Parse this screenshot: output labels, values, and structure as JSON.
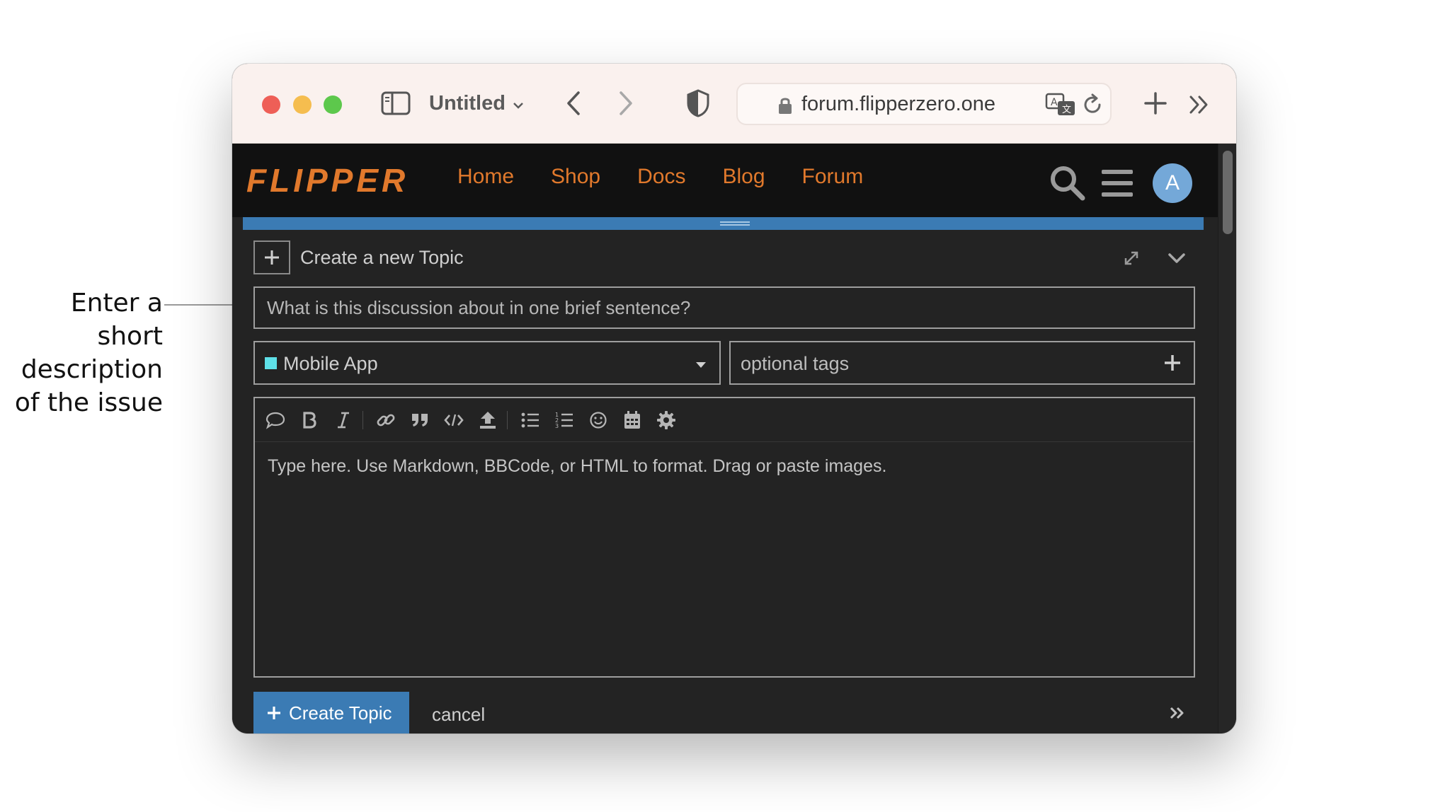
{
  "annotation": {
    "lines": [
      "Enter a short",
      "description",
      "of the issue"
    ]
  },
  "browser": {
    "tab_title": "Untitled",
    "url": "forum.flipperzero.one",
    "icons": {
      "sidebar": "sidebar-icon",
      "back": "chevron-left-icon",
      "forward": "chevron-right-icon",
      "privacy": "shield-icon",
      "lock": "lock-icon",
      "translate": "translate-icon",
      "reload": "reload-icon",
      "new_tab": "plus-icon",
      "more": "double-chevron-right-icon"
    }
  },
  "site": {
    "logo_text": "FLIPPER",
    "nav": [
      "Home",
      "Shop",
      "Docs",
      "Blog",
      "Forum"
    ],
    "avatar_letter": "A",
    "colors": {
      "accent": "#e1792c",
      "header_bg": "#111111",
      "primary": "#3b7bb4"
    }
  },
  "composer": {
    "title": "Create a new Topic",
    "title_placeholder": "What is this discussion about in one brief sentence?",
    "category": {
      "label": "Mobile App",
      "color": "#5ee0e8"
    },
    "tags_placeholder": "optional tags",
    "toolbar": [
      "quote-icon",
      "bold-icon",
      "italic-icon",
      "link-icon",
      "blockquote-icon",
      "code-icon",
      "upload-icon",
      "bullet-list-icon",
      "numbered-list-icon",
      "emoji-icon",
      "calendar-icon",
      "gear-icon"
    ],
    "editor_placeholder": "Type here. Use Markdown, BBCode, or HTML to format. Drag or paste images.",
    "create_label": "Create Topic",
    "cancel_label": "cancel"
  }
}
